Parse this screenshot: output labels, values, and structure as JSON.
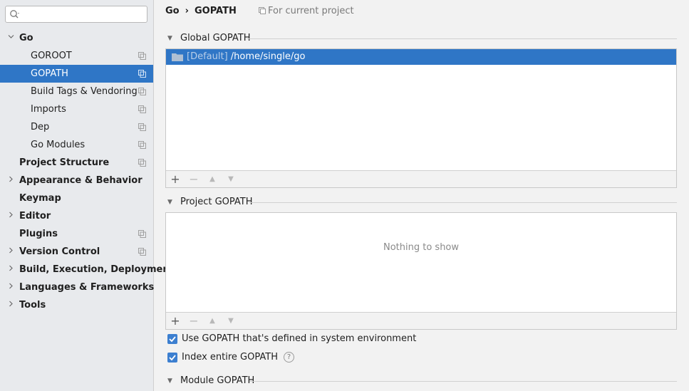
{
  "search": {
    "placeholder": "",
    "value": ""
  },
  "sidebar": {
    "items": [
      {
        "label": "Go",
        "bold": true,
        "arrow": "expanded",
        "indent": 1,
        "project_icon": false
      },
      {
        "label": "GOROOT",
        "bold": false,
        "arrow": "none",
        "indent": 2,
        "project_icon": true
      },
      {
        "label": "GOPATH",
        "bold": false,
        "arrow": "none",
        "indent": 2,
        "project_icon": true,
        "selected": true
      },
      {
        "label": "Build Tags & Vendoring",
        "bold": false,
        "arrow": "none",
        "indent": 2,
        "project_icon": true
      },
      {
        "label": "Imports",
        "bold": false,
        "arrow": "none",
        "indent": 2,
        "project_icon": true
      },
      {
        "label": "Dep",
        "bold": false,
        "arrow": "none",
        "indent": 2,
        "project_icon": true
      },
      {
        "label": "Go Modules",
        "bold": false,
        "arrow": "none",
        "indent": 2,
        "project_icon": true
      },
      {
        "label": "Project Structure",
        "bold": true,
        "arrow": "none",
        "indent": 1,
        "project_icon": true
      },
      {
        "label": "Appearance & Behavior",
        "bold": true,
        "arrow": "collapsed",
        "indent": 1,
        "project_icon": false
      },
      {
        "label": "Keymap",
        "bold": true,
        "arrow": "none",
        "indent": 1,
        "project_icon": false
      },
      {
        "label": "Editor",
        "bold": true,
        "arrow": "collapsed",
        "indent": 1,
        "project_icon": false
      },
      {
        "label": "Plugins",
        "bold": true,
        "arrow": "none",
        "indent": 1,
        "project_icon": true
      },
      {
        "label": "Version Control",
        "bold": true,
        "arrow": "collapsed",
        "indent": 1,
        "project_icon": true
      },
      {
        "label": "Build, Execution, Deployment",
        "bold": true,
        "arrow": "collapsed",
        "indent": 1,
        "project_icon": false
      },
      {
        "label": "Languages & Frameworks",
        "bold": true,
        "arrow": "collapsed",
        "indent": 1,
        "project_icon": false
      },
      {
        "label": "Tools",
        "bold": true,
        "arrow": "collapsed",
        "indent": 1,
        "project_icon": false
      }
    ]
  },
  "breadcrumb": {
    "parent": "Go",
    "separator": "›",
    "current": "GOPATH"
  },
  "scope_note": "For current project",
  "global_gopath": {
    "title": "Global GOPATH",
    "entries": [
      {
        "prefix": "[Default]",
        "path": "/home/single/go",
        "selected": true
      }
    ],
    "toolbar": {
      "add": "+",
      "remove": "−",
      "up": "▲",
      "down": "▼"
    }
  },
  "project_gopath": {
    "title": "Project GOPATH",
    "empty_text": "Nothing to show",
    "toolbar": {
      "add": "+",
      "remove": "−",
      "up": "▲",
      "down": "▼"
    }
  },
  "options": {
    "use_system_gopath": {
      "label": "Use GOPATH that's defined in system environment",
      "checked": true
    },
    "index_entire_gopath": {
      "label": "Index entire GOPATH",
      "checked": true,
      "help": "?"
    }
  },
  "module_gopath": {
    "title": "Module GOPATH"
  },
  "colors": {
    "selection": "#2f76c6",
    "checkbox": "#3c7fd0",
    "sidebar_bg": "#e8eaed",
    "content_bg": "#f2f2f2"
  }
}
